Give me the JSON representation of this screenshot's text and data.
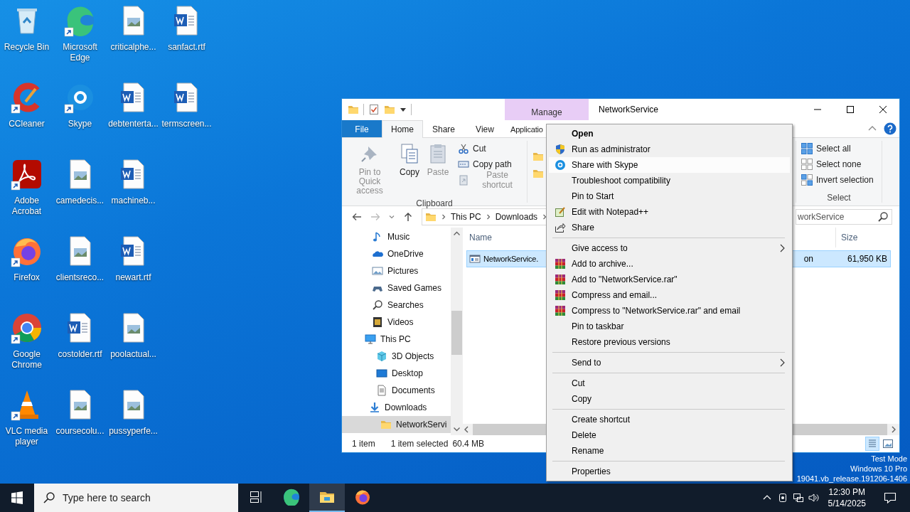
{
  "desktop": {
    "icons": [
      {
        "label": "Recycle Bin",
        "kind": "recycle",
        "shortcut": false
      },
      {
        "label": "CCleaner",
        "kind": "ccleaner",
        "shortcut": true
      },
      {
        "label": "Adobe Acrobat",
        "kind": "acrobat",
        "shortcut": true
      },
      {
        "label": "Firefox",
        "kind": "firefox",
        "shortcut": true
      },
      {
        "label": "Google Chrome",
        "kind": "chrome",
        "shortcut": true
      },
      {
        "label": "VLC media player",
        "kind": "vlc",
        "shortcut": true
      },
      {
        "label": "Microsoft Edge",
        "kind": "edge",
        "shortcut": true
      },
      {
        "label": "Skype",
        "kind": "skype",
        "shortcut": true
      },
      {
        "label": "camedecis...",
        "kind": "image",
        "shortcut": false
      },
      {
        "label": "clientsreco...",
        "kind": "image",
        "shortcut": false
      },
      {
        "label": "costolder.rtf",
        "kind": "word",
        "shortcut": false
      },
      {
        "label": "coursecolu...",
        "kind": "image",
        "shortcut": false
      },
      {
        "label": "criticalphe...",
        "kind": "image",
        "shortcut": false
      },
      {
        "label": "debtenterta...",
        "kind": "word",
        "shortcut": false
      },
      {
        "label": "machineb...",
        "kind": "word",
        "shortcut": false
      },
      {
        "label": "newart.rtf",
        "kind": "word",
        "shortcut": false
      },
      {
        "label": "poolactual...",
        "kind": "image",
        "shortcut": false
      },
      {
        "label": "pussyperfe...",
        "kind": "image",
        "shortcut": false
      },
      {
        "label": "sanfact.rtf",
        "kind": "word",
        "shortcut": false
      },
      {
        "label": "termscreen...",
        "kind": "word",
        "shortcut": false
      }
    ]
  },
  "explorer": {
    "context_tab": "Manage",
    "title": "NetworkService",
    "ribbon_tabs": [
      {
        "label": "File",
        "kind": "file",
        "selected": false
      },
      {
        "label": "Home",
        "kind": "tab",
        "selected": true
      },
      {
        "label": "Share",
        "kind": "tab",
        "selected": false
      },
      {
        "label": "View",
        "kind": "tab",
        "selected": false
      },
      {
        "label": "Applicatio",
        "kind": "contextual",
        "selected": false
      }
    ],
    "clipboard": {
      "label": "Clipboard",
      "large_buttons": [
        {
          "label": "Pin to Quick access",
          "kind": "pin",
          "disabled": true
        },
        {
          "label": "Copy",
          "kind": "copy",
          "disabled": false
        },
        {
          "label": "Paste",
          "kind": "paste",
          "disabled": true
        }
      ],
      "small_buttons": [
        {
          "label": "Cut",
          "kind": "cut",
          "disabled": false
        },
        {
          "label": "Copy path",
          "kind": "copypath",
          "disabled": false
        },
        {
          "label": "Paste shortcut",
          "kind": "pasteshortcut",
          "disabled": true
        }
      ]
    },
    "select": {
      "label": "Select",
      "buttons": [
        {
          "label": "Select all",
          "kind": "selectall"
        },
        {
          "label": "Select none",
          "kind": "selectnone"
        },
        {
          "label": "Invert selection",
          "kind": "invert"
        }
      ]
    },
    "address": {
      "path": [
        "This PC",
        "Downloads"
      ]
    },
    "search": {
      "value": "workService"
    },
    "nav": [
      {
        "label": "Music",
        "kind": "music",
        "selected": false
      },
      {
        "label": "OneDrive",
        "kind": "onedrive",
        "selected": false
      },
      {
        "label": "Pictures",
        "kind": "pictures",
        "selected": false
      },
      {
        "label": "Saved Games",
        "kind": "games",
        "selected": false
      },
      {
        "label": "Searches",
        "kind": "search",
        "selected": false
      },
      {
        "label": "Videos",
        "kind": "videos",
        "selected": false
      },
      {
        "label": "This PC",
        "kind": "pc",
        "selected": false,
        "children": [
          {
            "label": "3D Objects",
            "kind": "objects",
            "selected": false
          },
          {
            "label": "Desktop",
            "kind": "desktop",
            "selected": false
          },
          {
            "label": "Documents",
            "kind": "documents",
            "selected": false
          },
          {
            "label": "Downloads",
            "kind": "downloads",
            "selected": false,
            "children": [
              {
                "label": "NetworkServi",
                "kind": "folder",
                "selected": true
              }
            ]
          }
        ]
      }
    ],
    "columns": [
      "Name",
      "Size"
    ],
    "files": [
      {
        "name": "NetworkService.",
        "type": "on",
        "size": "61,950 KB",
        "selected": true
      }
    ],
    "status": {
      "count": "1 item",
      "selection": "1 item selected",
      "size": "60.4 MB"
    },
    "views": [
      {
        "kind": "details",
        "selected": true
      },
      {
        "kind": "large",
        "selected": false
      }
    ]
  },
  "context_menu": {
    "sections": [
      {
        "items": [
          {
            "label": "Open",
            "kind": "plain",
            "default": true,
            "submenu": false,
            "selected": false
          },
          {
            "label": "Run as administrator",
            "kind": "shield",
            "default": false,
            "submenu": false,
            "selected": false
          },
          {
            "label": "Share with Skype",
            "kind": "skype",
            "default": false,
            "submenu": false,
            "selected": true
          },
          {
            "label": "Troubleshoot compatibility",
            "kind": "plain",
            "default": false,
            "submenu": false,
            "selected": false
          },
          {
            "label": "Pin to Start",
            "kind": "plain",
            "default": false,
            "submenu": false,
            "selected": false
          },
          {
            "label": "Edit with Notepad++",
            "kind": "notepad",
            "default": false,
            "submenu": false,
            "selected": false
          },
          {
            "label": "Share",
            "kind": "share",
            "default": false,
            "submenu": false,
            "selected": false
          }
        ]
      },
      {
        "items": [
          {
            "label": "Give access to",
            "kind": "plain",
            "default": false,
            "submenu": true,
            "selected": false
          },
          {
            "label": "Add to archive...",
            "kind": "winrar",
            "default": false,
            "submenu": false,
            "selected": false
          },
          {
            "label": "Add to \"NetworkService.rar\"",
            "kind": "winrar",
            "default": false,
            "submenu": false,
            "selected": false
          },
          {
            "label": "Compress and email...",
            "kind": "winrar",
            "default": false,
            "submenu": false,
            "selected": false
          },
          {
            "label": "Compress to \"NetworkService.rar\" and email",
            "kind": "winrar",
            "default": false,
            "submenu": false,
            "selected": false
          },
          {
            "label": "Pin to taskbar",
            "kind": "plain",
            "default": false,
            "submenu": false,
            "selected": false
          },
          {
            "label": "Restore previous versions",
            "kind": "plain",
            "default": false,
            "submenu": false,
            "selected": false
          }
        ]
      },
      {
        "items": [
          {
            "label": "Send to",
            "kind": "plain",
            "default": false,
            "submenu": true,
            "selected": false
          }
        ]
      },
      {
        "items": [
          {
            "label": "Cut",
            "kind": "plain",
            "default": false,
            "submenu": false,
            "selected": false
          },
          {
            "label": "Copy",
            "kind": "plain",
            "default": false,
            "submenu": false,
            "selected": false
          }
        ]
      },
      {
        "items": [
          {
            "label": "Create shortcut",
            "kind": "plain",
            "default": false,
            "submenu": false,
            "selected": false
          },
          {
            "label": "Delete",
            "kind": "plain",
            "default": false,
            "submenu": false,
            "selected": false
          },
          {
            "label": "Rename",
            "kind": "plain",
            "default": false,
            "submenu": false,
            "selected": false
          }
        ]
      },
      {
        "items": [
          {
            "label": "Properties",
            "kind": "plain",
            "default": false,
            "submenu": false,
            "selected": false
          }
        ]
      }
    ]
  },
  "system_info": [
    "Test Mode",
    "Windows 10 Pro",
    "19041.vb_release.191206-1406"
  ],
  "taskbar": {
    "search_placeholder": "Type here to search",
    "apps": [
      {
        "kind": "taskview",
        "active": false
      },
      {
        "kind": "edge",
        "active": false
      },
      {
        "kind": "explorer",
        "active": true
      },
      {
        "kind": "firefox",
        "active": false
      }
    ],
    "time": "12:30 PM",
    "date": "5/14/2025"
  }
}
